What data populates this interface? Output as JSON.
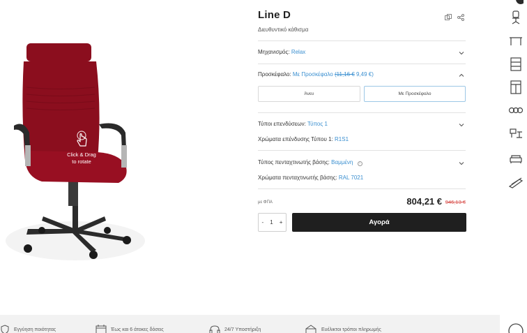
{
  "product": {
    "title": "Line D",
    "subtitle": "Διευθυντικό κάθισμα"
  },
  "viewer": {
    "hint_line1": "Click & Drag",
    "hint_line2": "to rotate",
    "chair_color": "#8b0e1e"
  },
  "options": {
    "mechanism_label": "Μηχανισμός:",
    "mechanism_value": "Relax",
    "headrest_label": "Προσκέφαλο:",
    "headrest_value": "Με Προσκέφαλο",
    "headrest_old_price": "(11,16 €",
    "headrest_new_price": "9,49 €)",
    "headrest_choices": [
      "Άνευ",
      "Με Προσκέφαλο"
    ],
    "upholstery_label": "Τύποι επενδύσεων:",
    "upholstery_value": "Τύπος 1",
    "upholstery_color_label": "Χρώματα επένδυσης Τύπου 1:",
    "upholstery_color_value": "R1S1",
    "base_label": "Τύπος πενταχτινωτής βάσης:",
    "base_value": "Βαμμένη",
    "base_color_label": "Χρώματα πενταχτινωτής βάσης:",
    "base_color_value": "RAL 7021"
  },
  "pricing": {
    "vat_note": "με ΦΠΑ",
    "price": "804,21 €",
    "old_price": "946,13 €"
  },
  "cart": {
    "minus": "-",
    "quantity": "1",
    "plus": "+",
    "buy_label": "Αγορά"
  },
  "footer": {
    "items": [
      "Εγγύηση ποιότητας",
      "Έως και 6 άτοκες δόσεις",
      "24/7 Υποστήριξη",
      "Ευέλικτοι τρόποι πληρωμής"
    ]
  },
  "colors": {
    "accent": "#3a8fd0",
    "buy_bg": "#1f1f1f",
    "old_price": "#d9534f"
  }
}
